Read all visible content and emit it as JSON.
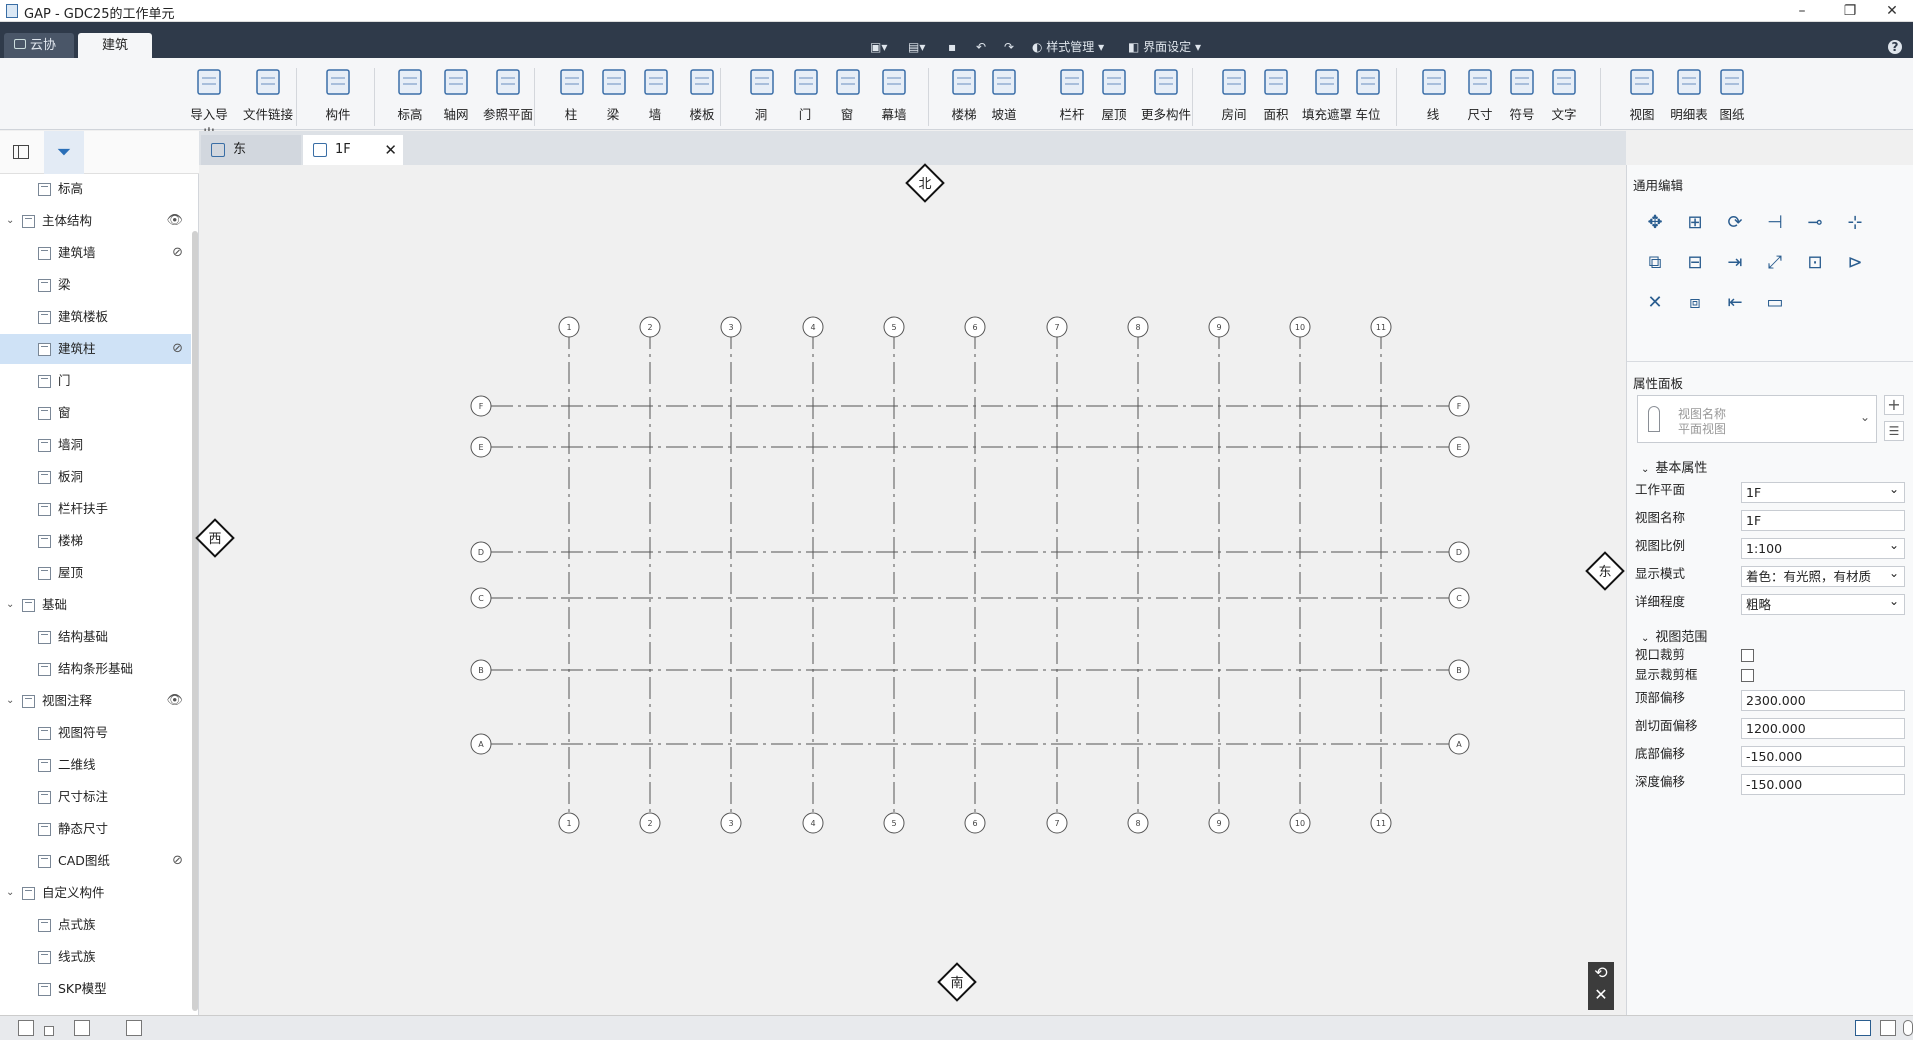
{
  "window": {
    "title": "GAP - GDC25的工作单元",
    "minimize": "–",
    "restore": "❐",
    "close": "✕"
  },
  "apptabs": {
    "cloud": "云协同",
    "arch": "建筑"
  },
  "quickaccess": {
    "style_mgr": "样式管理",
    "ui_setting": "界面设定",
    "help": "?"
  },
  "ribbon": [
    {
      "label": "导入导出",
      "icon": "cad-import-icon"
    },
    {
      "label": "文件链接",
      "icon": "file-link-icon"
    },
    {
      "label": "构件",
      "icon": "component-icon"
    },
    {
      "label": "标高",
      "icon": "level-icon"
    },
    {
      "label": "轴网",
      "icon": "grid-icon"
    },
    {
      "label": "参照平面",
      "icon": "ref-plane-icon"
    },
    {
      "label": "柱",
      "icon": "column-icon"
    },
    {
      "label": "梁",
      "icon": "beam-icon"
    },
    {
      "label": "墙",
      "icon": "wall-icon"
    },
    {
      "label": "楼板",
      "icon": "floor-icon"
    },
    {
      "label": "洞",
      "icon": "opening-icon"
    },
    {
      "label": "门",
      "icon": "door-icon"
    },
    {
      "label": "窗",
      "icon": "window-icon"
    },
    {
      "label": "幕墙",
      "icon": "curtain-wall-icon"
    },
    {
      "label": "楼梯",
      "icon": "stair-icon"
    },
    {
      "label": "坡道",
      "icon": "ramp-icon"
    },
    {
      "label": "栏杆",
      "icon": "railing-icon"
    },
    {
      "label": "屋顶",
      "icon": "roof-icon"
    },
    {
      "label": "更多构件",
      "icon": "more-components-icon"
    },
    {
      "label": "房间",
      "icon": "room-icon"
    },
    {
      "label": "面积",
      "icon": "area-icon"
    },
    {
      "label": "填充遮罩",
      "icon": "fill-mask-icon"
    },
    {
      "label": "车位",
      "icon": "parking-icon"
    },
    {
      "label": "线",
      "icon": "line-icon"
    },
    {
      "label": "尺寸",
      "icon": "dimension-icon"
    },
    {
      "label": "符号",
      "icon": "symbol-icon"
    },
    {
      "label": "文字",
      "icon": "text-icon"
    },
    {
      "label": "视图",
      "icon": "view-icon"
    },
    {
      "label": "明细表",
      "icon": "schedule-icon"
    },
    {
      "label": "图纸",
      "icon": "sheet-icon"
    }
  ],
  "tree": [
    {
      "label": "标高",
      "level": 1
    },
    {
      "label": "主体结构",
      "level": 0,
      "eye": "👁"
    },
    {
      "label": "建筑墙",
      "level": 1,
      "eye": "⊘"
    },
    {
      "label": "梁",
      "level": 1
    },
    {
      "label": "建筑楼板",
      "level": 1
    },
    {
      "label": "建筑柱",
      "level": 1,
      "eye": "⊘",
      "selected": true
    },
    {
      "label": "门",
      "level": 1
    },
    {
      "label": "窗",
      "level": 1
    },
    {
      "label": "墙洞",
      "level": 1
    },
    {
      "label": "板洞",
      "level": 1
    },
    {
      "label": "栏杆扶手",
      "level": 1
    },
    {
      "label": "楼梯",
      "level": 1
    },
    {
      "label": "屋顶",
      "level": 1
    },
    {
      "label": "基础",
      "level": 0
    },
    {
      "label": "结构基础",
      "level": 1
    },
    {
      "label": "结构条形基础",
      "level": 1
    },
    {
      "label": "视图注释",
      "level": 0,
      "eye": "👁"
    },
    {
      "label": "视图符号",
      "level": 1
    },
    {
      "label": "二维线",
      "level": 1
    },
    {
      "label": "尺寸标注",
      "level": 1
    },
    {
      "label": "静态尺寸",
      "level": 1
    },
    {
      "label": "CAD图纸",
      "level": 1,
      "eye": "⊘"
    },
    {
      "label": "自定义构件",
      "level": 0
    },
    {
      "label": "点式族",
      "level": 1
    },
    {
      "label": "线式族",
      "level": 1
    },
    {
      "label": "SKP模型",
      "level": 1
    }
  ],
  "doctabs": {
    "east": "东",
    "f1": "1F",
    "close": "✕"
  },
  "compass": {
    "north": "北",
    "south": "南",
    "west": "西",
    "east": "东"
  },
  "grid": {
    "vertical_labels": [
      "1",
      "2",
      "3",
      "4",
      "5",
      "6",
      "7",
      "8",
      "9",
      "10",
      "11"
    ],
    "horizontal_labels": [
      "F",
      "E",
      "D",
      "C",
      "B",
      "A"
    ]
  },
  "panel": {
    "general_edit": "通用编辑",
    "properties": "属性面板",
    "view_type_name": "视图名称",
    "view_type_sub": "平面视图",
    "basic_props": "基本属性",
    "rows": [
      {
        "label": "工作平面",
        "value": "1F",
        "dd": true
      },
      {
        "label": "视图名称",
        "value": "1F",
        "dd": false
      },
      {
        "label": "视图比例",
        "value": "1:100",
        "dd": true
      },
      {
        "label": "显示模式",
        "value": "着色：有光照，有材质",
        "dd": true
      },
      {
        "label": "详细程度",
        "value": "粗略",
        "dd": true
      }
    ],
    "view_range": "视图范围",
    "crop_view": "视口裁剪",
    "show_crop": "显示裁剪框",
    "rows2": [
      {
        "label": "顶部偏移",
        "value": "2300.000"
      },
      {
        "label": "剖切面偏移",
        "value": "1200.000"
      },
      {
        "label": "底部偏移",
        "value": "-150.000"
      },
      {
        "label": "深度偏移",
        "value": "-150.000"
      }
    ]
  }
}
